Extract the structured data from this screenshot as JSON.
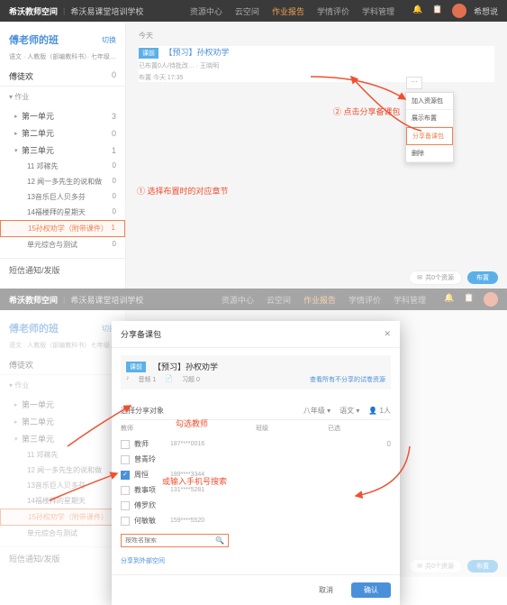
{
  "header": {
    "logo": "希沃教师空间",
    "site": "希沃易课堂培训学校",
    "nav": [
      "资源中心",
      "云空间",
      "作业报告",
      "学情评价",
      "学科管理"
    ],
    "active_index": 2,
    "user": "希想说"
  },
  "sidebar": {
    "title": "傅老师的班",
    "switch": "切换",
    "sub": "语文 · 人教版（部编教科书）· 七年级…",
    "tab": "傅徒欢",
    "tab_count": 0,
    "cat": "作业",
    "units": [
      {
        "label": "第一单元",
        "count": 3,
        "expanded": false
      },
      {
        "label": "第二单元",
        "count": 0,
        "expanded": false
      },
      {
        "label": "第三单元",
        "count": 1,
        "expanded": true,
        "children": [
          {
            "label": "11 邓稼先",
            "count": 0
          },
          {
            "label": "12 闻一多先生的说和做",
            "count": 0
          },
          {
            "label": "13音乐巨人贝多芬",
            "count": 0
          },
          {
            "label": "14福楼拜的星期天",
            "count": 0
          },
          {
            "label": "15孙权劝学（附带课件）",
            "count": 1,
            "selected": true
          },
          {
            "label": "单元综合与测试",
            "count": 0
          }
        ]
      }
    ],
    "bottom": "短信通知/发版"
  },
  "content": {
    "today": "今天",
    "hw_tag": "课前",
    "hw_title": "【预习】孙权劝学",
    "hw_meta": "已布置0人/待批改… · 王晓明",
    "hw_time": "布置  今天  17:35",
    "dropdown": [
      "加入资源包",
      "展示布置",
      "分享备课包",
      "删除"
    ],
    "footer_pill": "共0个资源",
    "footer_btn": "布置"
  },
  "annotations": {
    "a1": "① 选择布置时的对应章节",
    "a2": "② 点击分享备课包",
    "a3": "勾选教师",
    "a4": "或输入手机号搜索"
  },
  "modal": {
    "title": "分享备课包",
    "card_tag": "课前",
    "card_title": "【预习】孙权劝学",
    "card_audio": "音频 1",
    "card_hw": "习题 0",
    "card_link": "查看所有不分享的试卷资源",
    "filter_label": "选择分享对象",
    "filter_grade": "八年级",
    "filter_subj": "语文",
    "filter_num": "1人",
    "col_teacher": "教师",
    "col_class": "班级",
    "col_count": "已选",
    "teachers": [
      {
        "name": "教师",
        "phone": "187****0016",
        "checked": false
      },
      {
        "name": "曾青玲",
        "phone": "",
        "checked": false
      },
      {
        "name": "周恒",
        "phone": "189****3344",
        "checked": true
      },
      {
        "name": "教事项",
        "phone": "131****5281",
        "checked": false
      },
      {
        "name": "傅罗欣",
        "phone": "",
        "checked": false
      },
      {
        "name": "何敏敏",
        "phone": "159****5520",
        "checked": false
      }
    ],
    "search_placeholder": "按姓名搜索",
    "share_link": "分享到外部空间",
    "cancel": "取消",
    "ok": "确认"
  }
}
